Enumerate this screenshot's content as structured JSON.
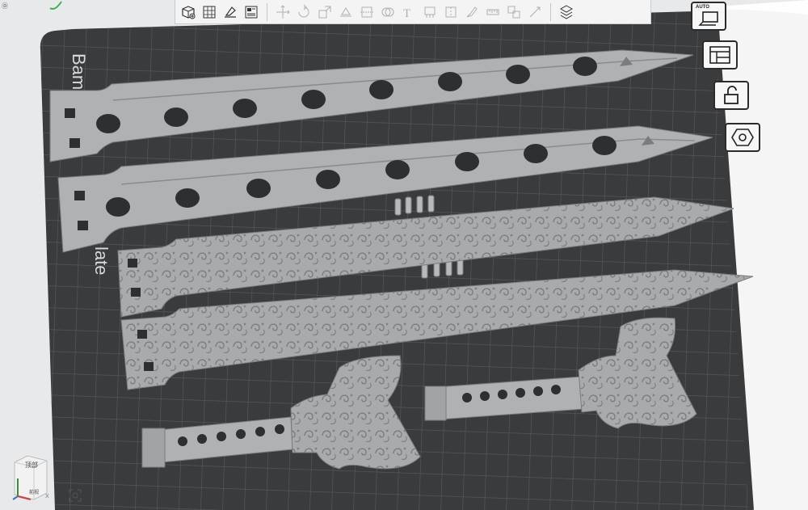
{
  "window": {
    "corner_indicator": "Ⓓ"
  },
  "viewport": {
    "plate_label": "Bambu Textured PEI Plate",
    "plate_label_top": "Bam",
    "plate_label_bottom": "late"
  },
  "toolbar": {
    "items": [
      {
        "name": "add-cube-icon",
        "enabled": true
      },
      {
        "name": "grid-arrange-icon",
        "enabled": true
      },
      {
        "name": "orient-icon",
        "enabled": true
      },
      {
        "name": "layout-icon",
        "enabled": true
      },
      {
        "sep": true
      },
      {
        "name": "move-icon",
        "enabled": false
      },
      {
        "name": "rotate-icon",
        "enabled": false
      },
      {
        "name": "scale-icon",
        "enabled": false
      },
      {
        "name": "lay-on-face-icon",
        "enabled": false
      },
      {
        "name": "cut-icon",
        "enabled": false
      },
      {
        "name": "mesh-boolean-icon",
        "enabled": false
      },
      {
        "name": "text-icon",
        "enabled": false
      },
      {
        "name": "support-paint-icon",
        "enabled": false
      },
      {
        "name": "seam-paint-icon",
        "enabled": false
      },
      {
        "name": "color-paint-icon",
        "enabled": false
      },
      {
        "name": "measure-icon",
        "enabled": false
      },
      {
        "name": "assembly-icon",
        "enabled": false
      },
      {
        "name": "split-icon",
        "enabled": false
      },
      {
        "sep": true
      },
      {
        "name": "variable-layer-icon",
        "enabled": true
      }
    ],
    "text_tool_glyph": "T"
  },
  "right_tools": {
    "auto_label": "AUTO",
    "items": [
      "auto-orient-icon",
      "arrange-plate-icon",
      "lock-plate-icon",
      "plate-settings-icon"
    ]
  },
  "view_cube": {
    "top_label": "顶部",
    "front_label": "前视",
    "axis_x": "X"
  },
  "colors": {
    "plate": "#3a3b3d",
    "grid": "#56585b",
    "model": "#a6a7a9",
    "background": "#e8e9eb"
  }
}
